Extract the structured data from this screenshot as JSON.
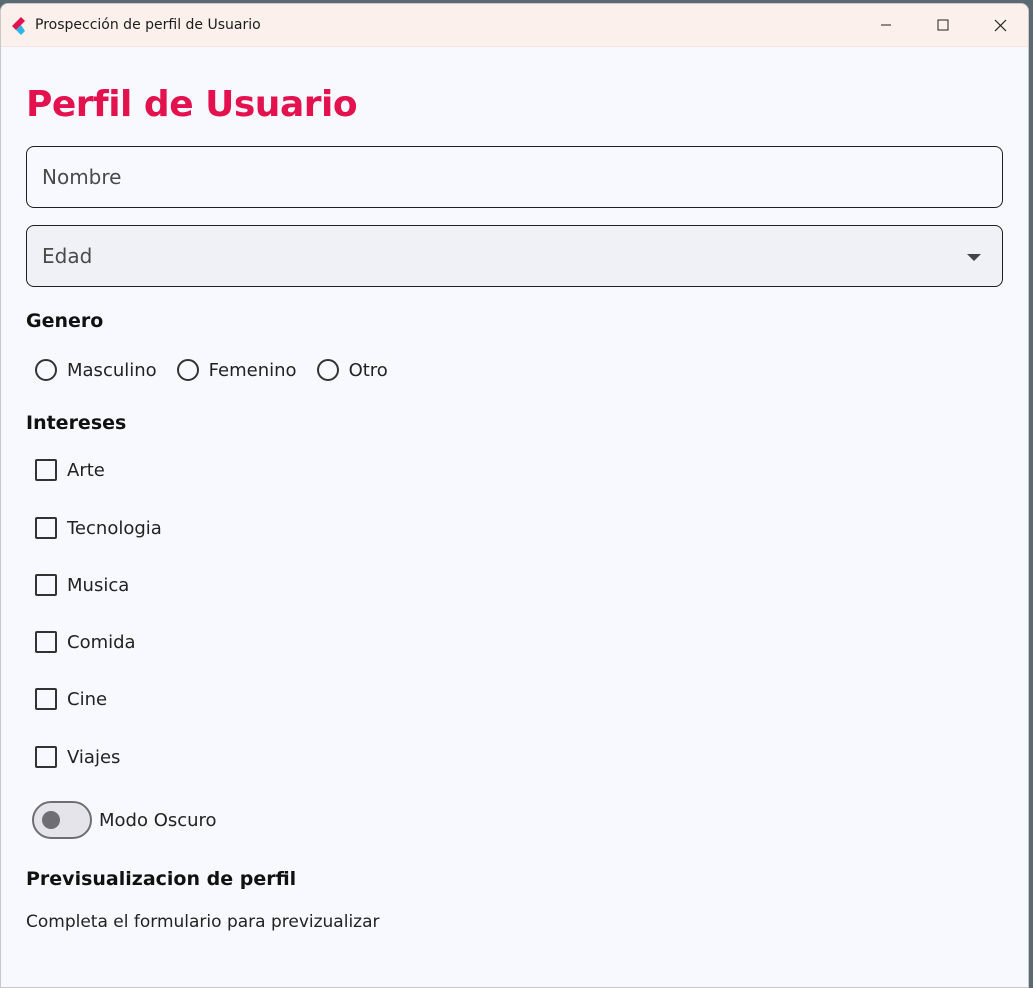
{
  "window": {
    "title": "Prospección de perfil de Usuario",
    "buttons": {
      "minimize": "minimize-icon",
      "maximize": "maximize-icon",
      "close": "close-icon"
    }
  },
  "form": {
    "title": "Perfil de Usuario",
    "nombre": {
      "placeholder": "Nombre",
      "value": ""
    },
    "edad": {
      "placeholder": "Edad",
      "value": ""
    },
    "genero": {
      "label": "Genero",
      "options": [
        "Masculino",
        "Femenino",
        "Otro"
      ],
      "selected": null
    },
    "intereses": {
      "label": "Intereses",
      "options": [
        "Arte",
        "Tecnologia",
        "Musica",
        "Comida",
        "Cine",
        "Viajes"
      ],
      "checked": [
        false,
        false,
        false,
        false,
        false,
        false
      ]
    },
    "modo_oscuro": {
      "label": "Modo Oscuro",
      "on": false
    },
    "preview": {
      "title": "Previsualizacion de perfil",
      "text": "Completa el formulario para previzualizar"
    }
  },
  "colors": {
    "accent": "#e3124f",
    "background": "#f8f9fe",
    "titlebar": "#fbf0ec"
  }
}
